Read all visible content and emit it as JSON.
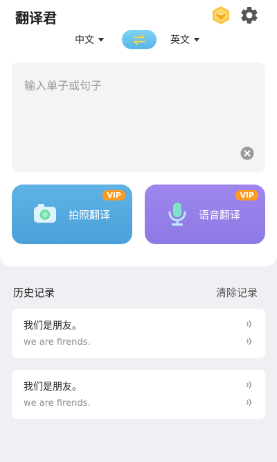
{
  "header": {
    "title": "翻译君",
    "vip_icon": "vip-diamond-badge-icon",
    "settings_icon": "gear-icon"
  },
  "language_bar": {
    "source_lang": "中文",
    "target_lang": "英文",
    "swap_icon": "swap-arrows-icon"
  },
  "input": {
    "placeholder": "输入单子或句子",
    "clear_icon": "clear-icon"
  },
  "features": [
    {
      "label": "拍照翻译",
      "tag": "VIP",
      "icon": "camera-icon"
    },
    {
      "label": "语音翻译",
      "tag": "VIP",
      "icon": "microphone-icon"
    }
  ],
  "history": {
    "title": "历史记录",
    "clear_label": "清除记录",
    "items": [
      {
        "source": "我们是朋友。",
        "translation": "we are firends."
      },
      {
        "source": "我们是朋友。",
        "translation": "we are firends."
      }
    ]
  },
  "colors": {
    "accent_blue": "#58b5ea",
    "accent_purple": "#8d79e4",
    "vip_orange": "#ff9a1f",
    "badge_gold": "#f6c33b"
  }
}
